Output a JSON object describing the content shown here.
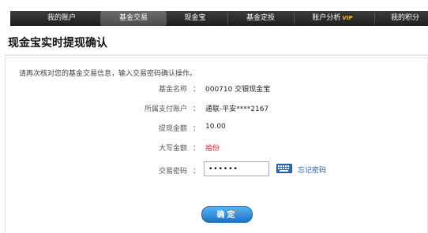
{
  "nav": {
    "items": [
      {
        "label": "我的账户"
      },
      {
        "label": "基金交易"
      },
      {
        "label": "现金宝"
      },
      {
        "label": "基金定投"
      },
      {
        "label": "账户分析",
        "badge": "VIP"
      },
      {
        "label": "我的积分"
      }
    ],
    "active_index": 1
  },
  "page": {
    "title": "现金宝实时提现确认",
    "instruction": "请再次核对您的基金交易信息，输入交易密码确认操作。"
  },
  "form": {
    "rows": [
      {
        "label": "基金名称",
        "value": "000710 交银现金宝"
      },
      {
        "label": "所属支付账户",
        "value": "通联-平安****2167"
      },
      {
        "label": "提现金额",
        "value": "10.00"
      },
      {
        "label": "大写金额",
        "value": "拾份"
      }
    ],
    "colon": "：",
    "password": {
      "label": "交易密码",
      "value": "••••••"
    },
    "keyboard_icon": "keyboard-icon",
    "forgot_link": "忘记密码",
    "confirm_label": "确定"
  },
  "colors": {
    "nav_bg": "#2a2a2a",
    "amount_red": "#d11e1e",
    "link_blue": "#1b5db5",
    "button_blue": "#2a86d8"
  }
}
